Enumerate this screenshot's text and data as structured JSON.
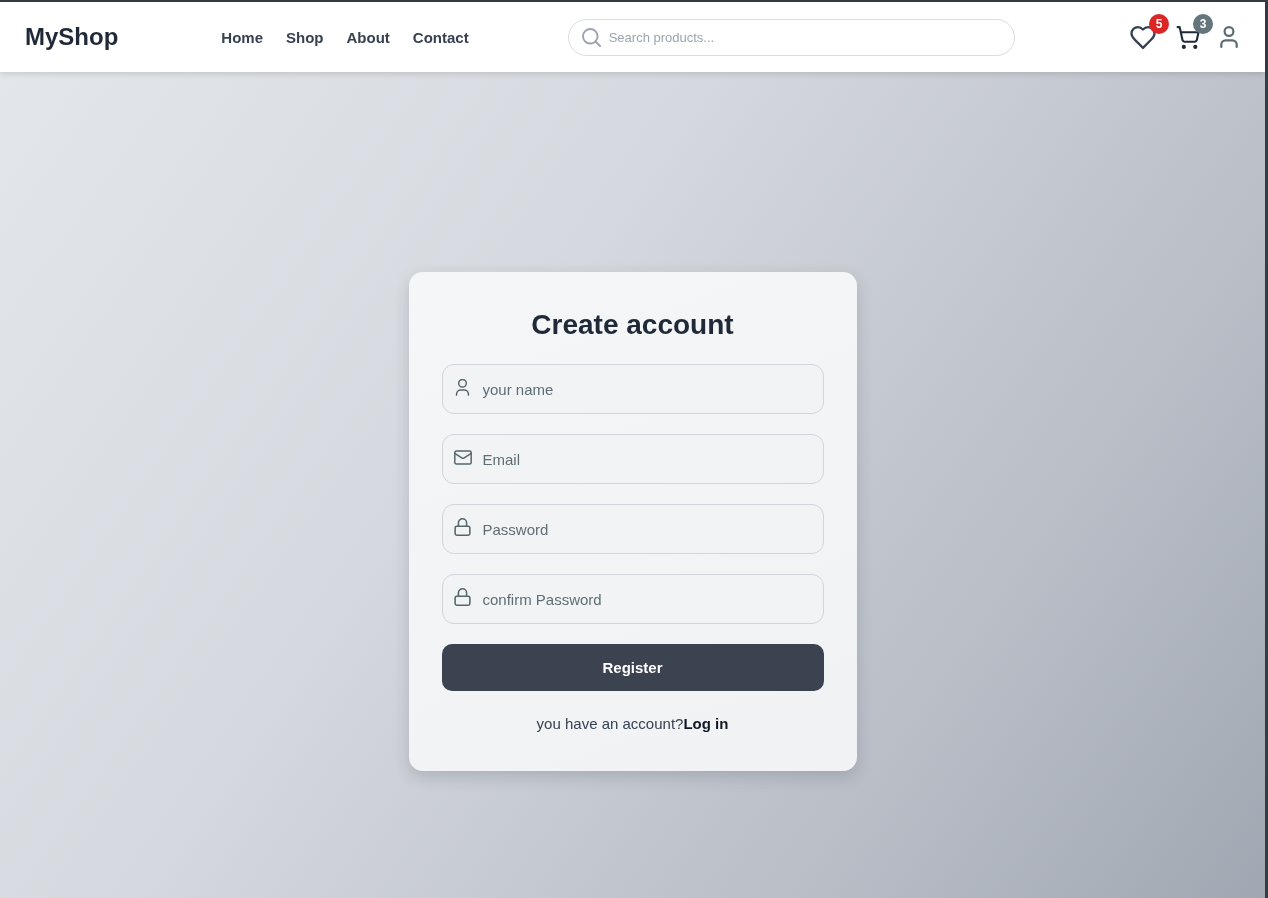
{
  "header": {
    "logo": "MyShop",
    "nav": [
      "Home",
      "Shop",
      "About",
      "Contact"
    ],
    "search": {
      "placeholder": "Search products..."
    },
    "actions": [
      {
        "kind": "wishlist",
        "badge": "5",
        "color": "#dc2626"
      },
      {
        "kind": "cart",
        "badge": "3",
        "color": "#64757b"
      },
      {
        "kind": "account"
      }
    ]
  },
  "form": {
    "title": "Create account",
    "fields": [
      {
        "kind": "name",
        "placeholder": "your name"
      },
      {
        "kind": "email",
        "placeholder": "Email"
      },
      {
        "kind": "password",
        "placeholder": "Password"
      },
      {
        "kind": "password",
        "placeholder": "confirm Password"
      }
    ],
    "submit": "Register",
    "footer": {
      "text": "you have an account?",
      "link": "Log in"
    }
  }
}
